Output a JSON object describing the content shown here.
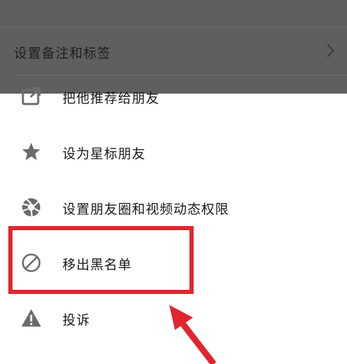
{
  "background": {
    "row_label": "设置备注和标签"
  },
  "menu": {
    "items": [
      {
        "label": "把他推荐给朋友",
        "icon": "share-icon"
      },
      {
        "label": "设为星标朋友",
        "icon": "star-icon"
      },
      {
        "label": "设置朋友圈和视频动态权限",
        "icon": "camera-shutter-icon"
      },
      {
        "label": "移出黑名单",
        "icon": "ban-icon"
      },
      {
        "label": "投诉",
        "icon": "warning-icon"
      }
    ]
  },
  "colors": {
    "overlay": "#5f5f5f",
    "icon": "#6b6b6b",
    "annotation": "#e1252f"
  }
}
